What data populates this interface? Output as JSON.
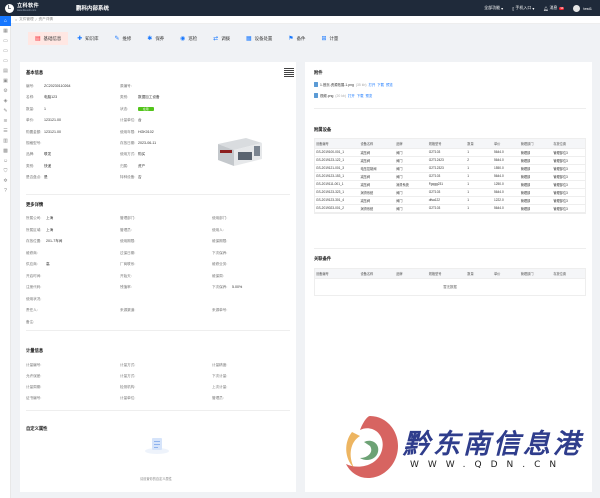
{
  "topbar": {
    "logo_glyph": "L",
    "logo_cn": "立科软件",
    "logo_en": "www.likesoft.com",
    "system_title": "鹏科内部系统",
    "all_functions": "全部功能",
    "mobile_entry": "手机入口",
    "messages": "消息",
    "message_count": "99",
    "username": "test1"
  },
  "sidebar": {
    "icons": [
      "home-icon",
      "calendar-icon",
      "folder-icon",
      "folder-icon",
      "folder-icon",
      "document-icon",
      "box-icon",
      "gear-icon",
      "cube-icon",
      "tool-icon",
      "layers-icon",
      "list-icon",
      "chart-icon",
      "grid-icon",
      "user-icon",
      "shield-icon",
      "settings-icon",
      "help-icon"
    ]
  },
  "breadcrumb": {
    "items": [
      "文件管理",
      "资产详情"
    ]
  },
  "tabs": [
    {
      "label": "基础信息",
      "icon": "document-icon",
      "active": true
    },
    {
      "label": "知识库",
      "icon": "book-icon"
    },
    {
      "label": "维修",
      "icon": "wrench-icon"
    },
    {
      "label": "保养",
      "icon": "maintenance-icon"
    },
    {
      "label": "巡检",
      "icon": "inspect-icon"
    },
    {
      "label": "调拨",
      "icon": "transfer-icon"
    },
    {
      "label": "设备处置",
      "icon": "dispose-icon"
    },
    {
      "label": "备件",
      "icon": "spare-icon"
    },
    {
      "label": "计量",
      "icon": "measure-icon"
    }
  ],
  "basic": {
    "title": "基本信息",
    "col1": [
      {
        "k": "编号:",
        "v": "ZC20230110264"
      },
      {
        "k": "名称:",
        "v": "电脑123"
      },
      {
        "k": "数量:",
        "v": "1"
      },
      {
        "k": "单价:",
        "v": "123121.00"
      },
      {
        "k": "购置金额:",
        "v": "123121.00"
      },
      {
        "k": "规格型号:",
        "v": ""
      },
      {
        "k": "品牌:",
        "v": "联发"
      },
      {
        "k": "类别:",
        "v": "快递"
      },
      {
        "k": "是否盘点:",
        "v": "是"
      }
    ],
    "col2": [
      {
        "k": "原编号:",
        "v": ""
      },
      {
        "k": "类别:",
        "v": "数据加工设备"
      },
      {
        "k": "状态:",
        "v": "在用"
      },
      {
        "k": "计量单位:",
        "v": "台"
      },
      {
        "k": "使用年限:",
        "v": "HGK0102"
      },
      {
        "k": "存放日期:",
        "v": "2023-06-11"
      },
      {
        "k": "使用方式:",
        "v": "购买"
      },
      {
        "k": "归属:",
        "v": "资产"
      },
      {
        "k": "特种设备:",
        "v": "否"
      }
    ]
  },
  "more": {
    "title": "更多详情",
    "rows": [
      [
        {
          "k": "所属公司:",
          "v": "上海"
        },
        {
          "k": "管理部门:",
          "v": ""
        },
        {
          "k": "使用部门:",
          "v": ""
        }
      ],
      [
        {
          "k": "所属区域:",
          "v": "上海"
        },
        {
          "k": "管理员:",
          "v": ""
        },
        {
          "k": "使用人:",
          "v": ""
        }
      ],
      [
        {
          "k": "存放位置:",
          "v": "201-7车间"
        },
        {
          "k": "使用期限:",
          "v": ""
        },
        {
          "k": "维保期限:",
          "v": ""
        }
      ],
      [
        {
          "k": "维修商:",
          "v": ""
        },
        {
          "k": "过保日期:",
          "v": ""
        },
        {
          "k": "下次保养:",
          "v": ""
        }
      ],
      [
        {
          "k": "供应商:",
          "v": "高"
        },
        {
          "k": "厂商联系:",
          "v": ""
        },
        {
          "k": "维修业务:",
          "v": ""
        }
      ],
      [
        {
          "k": "开启时间:",
          "v": ""
        },
        {
          "k": "开始天:",
          "v": ""
        },
        {
          "k": "维保周:",
          "v": ""
        }
      ],
      [
        {
          "k": "注册代码:",
          "v": ""
        },
        {
          "k": "残值率:",
          "v": ""
        },
        {
          "k": "下次保养:",
          "v": "5.00%"
        }
      ],
      [
        {
          "k": "使用状况:",
          "v": ""
        },
        {
          "k": "",
          "v": ""
        },
        {
          "k": "",
          "v": ""
        }
      ],
      [
        {
          "k": "责任人:",
          "v": ""
        },
        {
          "k": "来源渠道:",
          "v": ""
        },
        {
          "k": "来源单号:",
          "v": ""
        }
      ],
      [
        {
          "k": "备注:",
          "v": ""
        },
        {
          "k": "",
          "v": ""
        },
        {
          "k": "",
          "v": ""
        }
      ]
    ]
  },
  "metering": {
    "title": "计量信息",
    "rows": [
      [
        {
          "k": "计量编号:",
          "v": ""
        },
        {
          "k": "计量方式:",
          "v": ""
        },
        {
          "k": "计量精度:",
          "v": ""
        }
      ],
      [
        {
          "k": "允许误差:",
          "v": ""
        },
        {
          "k": "计量方式:",
          "v": ""
        },
        {
          "k": "下次计量:",
          "v": ""
        }
      ],
      [
        {
          "k": "计量周期:",
          "v": ""
        },
        {
          "k": "检测机构:",
          "v": ""
        },
        {
          "k": "上次计量:",
          "v": ""
        }
      ],
      [
        {
          "k": "证书编号:",
          "v": ""
        },
        {
          "k": "计量单位:",
          "v": ""
        },
        {
          "k": "管理员:",
          "v": ""
        }
      ]
    ]
  },
  "custom": {
    "title": "自定义属性",
    "empty_text": "请设置你的自定义属性"
  },
  "attachments": {
    "title": "附件",
    "files": [
      {
        "name": "1.首页-资源拓展-1.png",
        "size": "(35 kb)",
        "actions": [
          "打开",
          "下载",
          "预览"
        ]
      },
      {
        "name": "视频.png",
        "size": "(20 kb)",
        "actions": [
          "打开",
          "下载",
          "预览"
        ]
      }
    ]
  },
  "accessories": {
    "title": "附属设备",
    "headers": [
      "设备编号",
      "设备名称",
      "品牌",
      "规格型号",
      "数量",
      "单价",
      "管理部门",
      "存放位置"
    ],
    "rows": [
      [
        "GS-2019100-001_1",
        "减压阀",
        "阀门",
        "G2T103",
        "1",
        "5644.0",
        "管理部",
        "管理部位3"
      ],
      [
        "GS-2019123-122_1",
        "减压阀",
        "阀门",
        "G2T12423",
        "2",
        "5644.0",
        "管理部",
        "管理部位3"
      ],
      [
        "GS-2019121-001_3",
        "电压控制阀",
        "阀门",
        "G2T12323",
        "1",
        "1550.0",
        "管理部",
        "管理部位3"
      ],
      [
        "GS-2019123-153_1",
        "减压阀",
        "阀门",
        "G2T103",
        "1",
        "5644.0",
        "管理部",
        "管理部位3"
      ],
      [
        "GS-2019111-001_1",
        "减压阀",
        "润滑系统",
        "Fgqgg231",
        "1",
        "1250.0",
        "管理部",
        "管理部位3"
      ],
      [
        "GS-2019123-323_1",
        "润滑系统",
        "阀门",
        "G2T103",
        "1",
        "5644.0",
        "管理部",
        "管理部位3"
      ],
      [
        "GS-2019123-301_4",
        "减压阀",
        "阀门",
        "dfsa122",
        "1",
        "1222.0",
        "管理部",
        "管理部位3"
      ],
      [
        "GS-2019023-001_2",
        "润滑系统",
        "阀门",
        "G2T103",
        "1",
        "5644.0",
        "管理部",
        "管理部位3"
      ]
    ]
  },
  "related": {
    "title": "关联备件",
    "headers": [
      "设备编号",
      "设备名称",
      "品牌",
      "规格型号",
      "数量",
      "单价",
      "管理部门",
      "存放位置"
    ],
    "empty_text": "暂无数据"
  },
  "watermark": {
    "text_cn": "黔东南信息港",
    "url": "WWW.QDN.CN"
  }
}
